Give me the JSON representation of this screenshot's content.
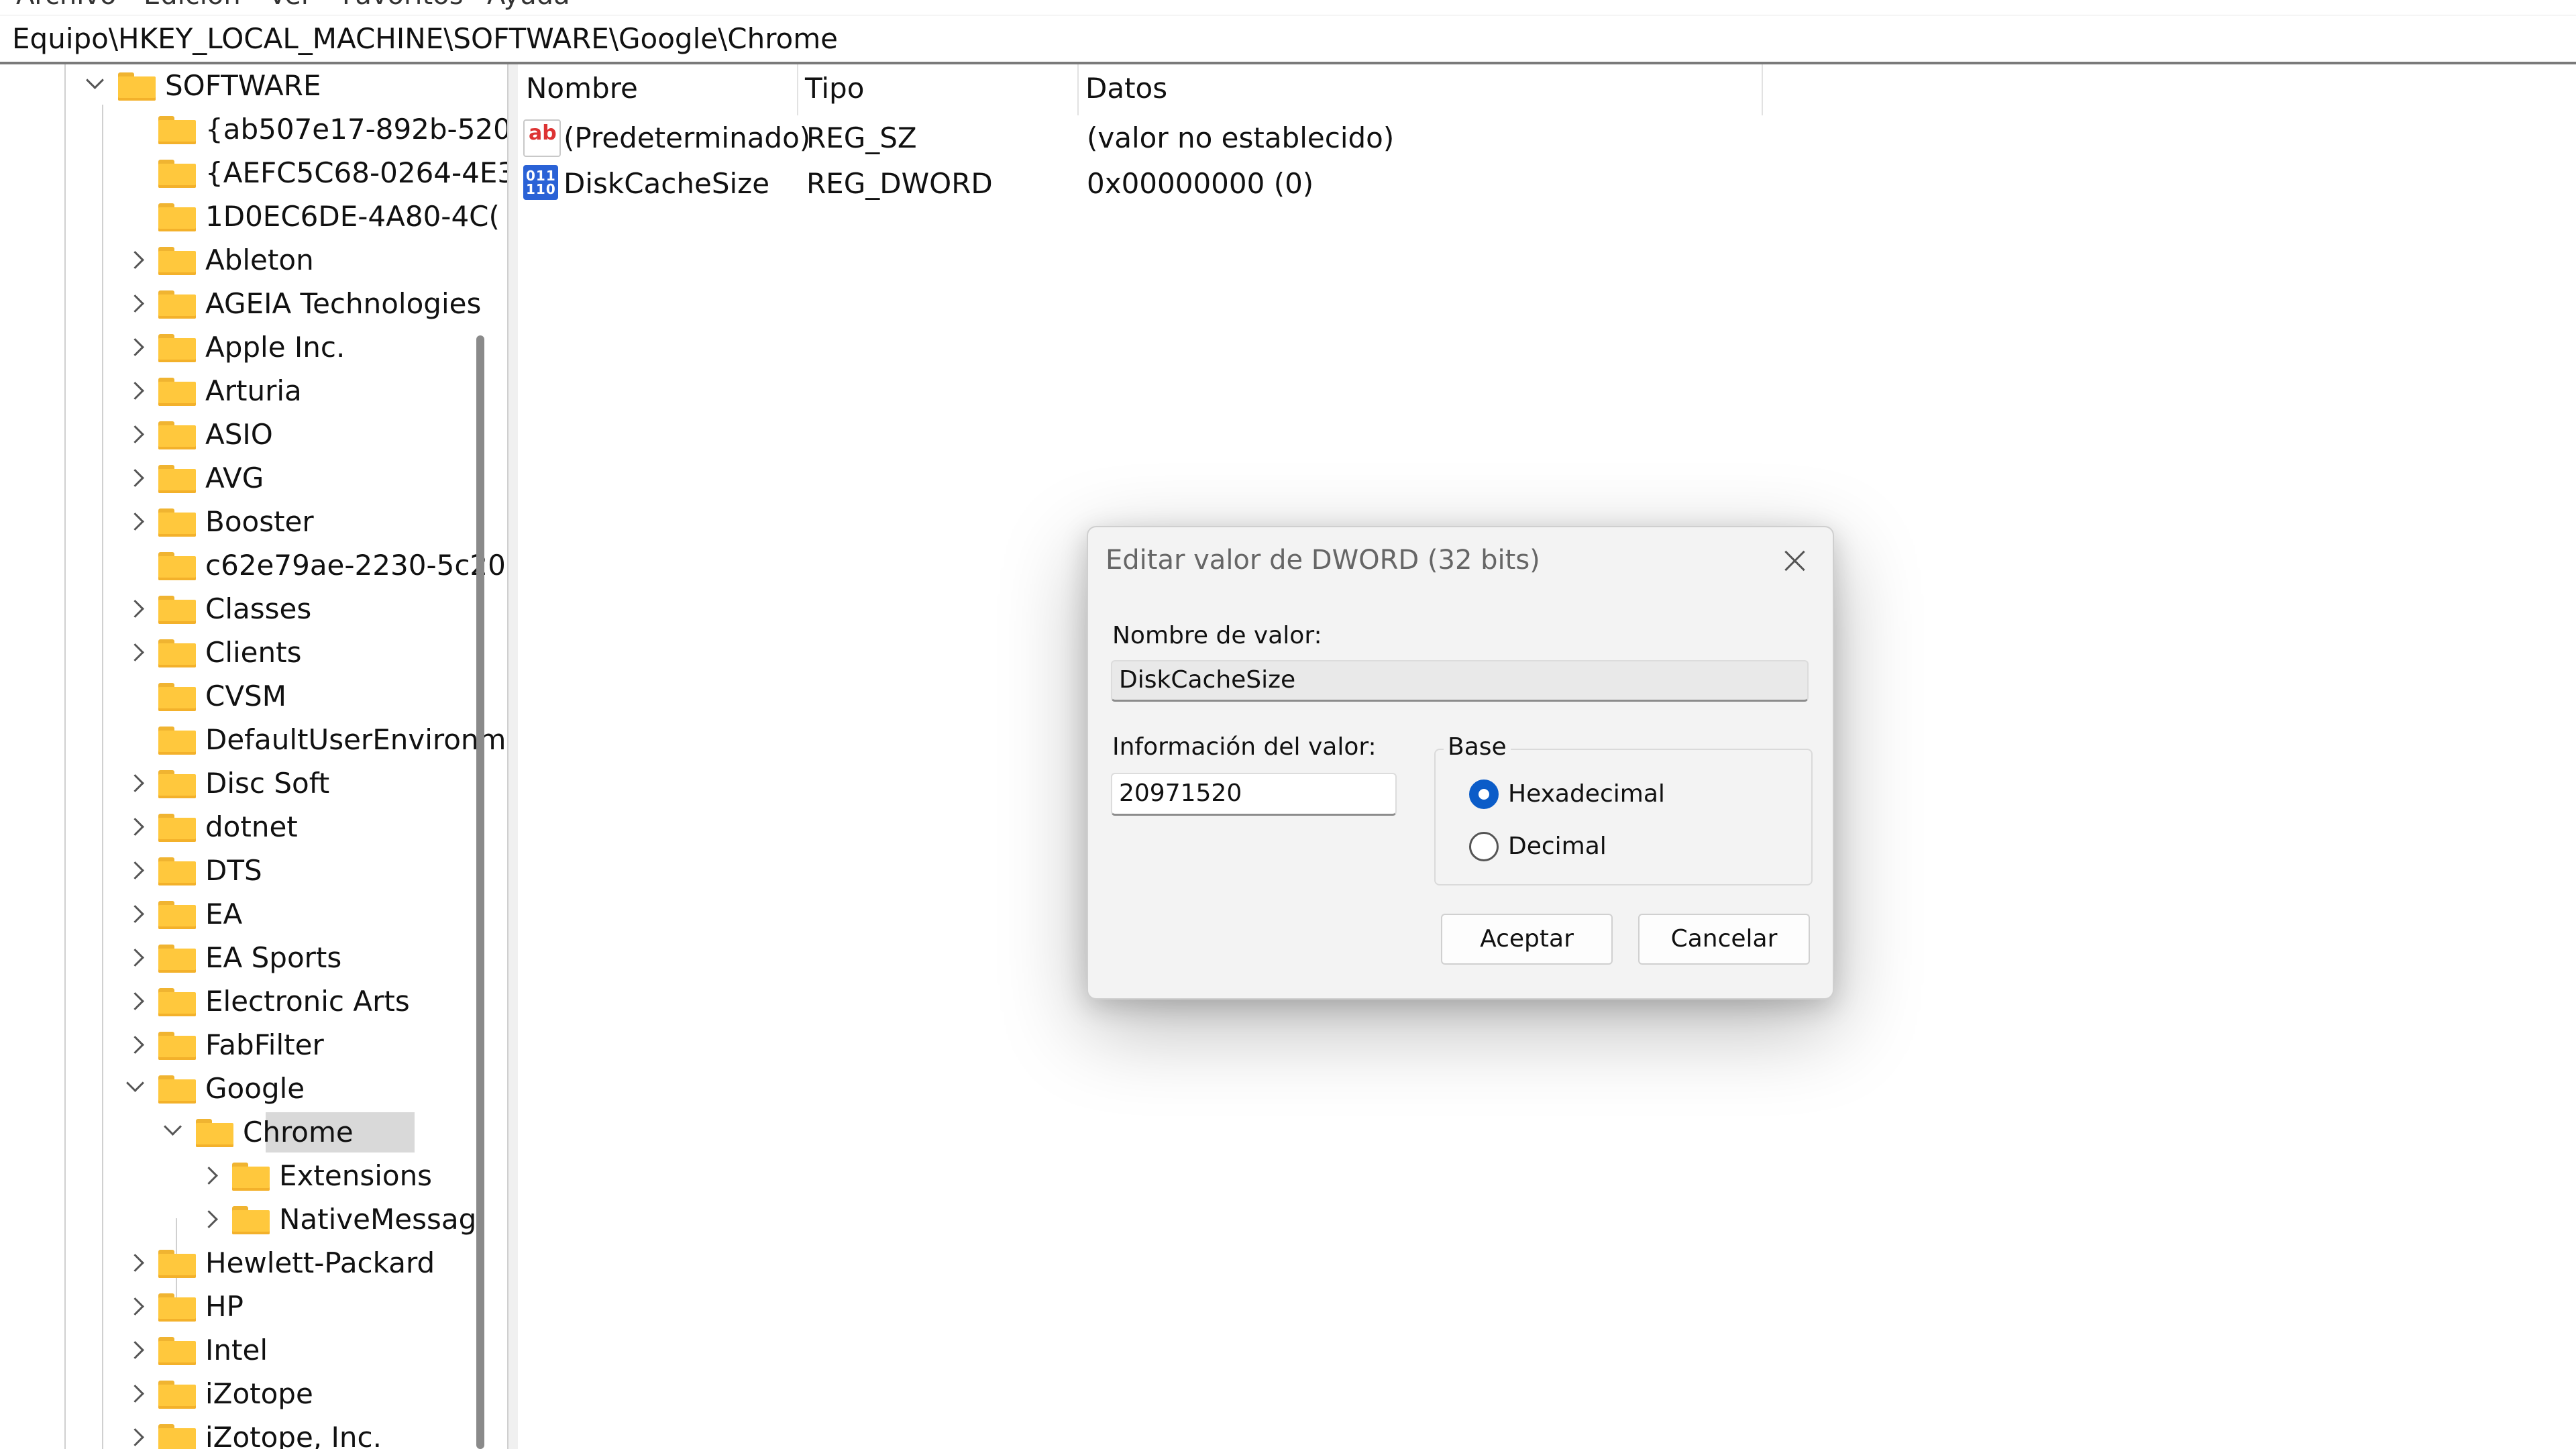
{
  "menubar": {
    "items": [
      "Archivo",
      "Edición",
      "Ver",
      "Favoritos",
      "Ayuda"
    ]
  },
  "address_bar": {
    "path": "Equipo\\HKEY_LOCAL_MACHINE\\SOFTWARE\\Google\\Chrome"
  },
  "tree": {
    "nodes": [
      {
        "label": "SOFTWARE",
        "expanded": true
      },
      {
        "label": "{ab507e17-892b-520"
      },
      {
        "label": "{AEFC5C68-0264-4E3"
      },
      {
        "label": "1D0EC6DE-4A80-4C("
      },
      {
        "label": "Ableton"
      },
      {
        "label": "AGEIA Technologies"
      },
      {
        "label": "Apple Inc."
      },
      {
        "label": "Arturia"
      },
      {
        "label": "ASIO"
      },
      {
        "label": "AVG"
      },
      {
        "label": "Booster"
      },
      {
        "label": "c62e79ae-2230-5c20"
      },
      {
        "label": "Classes"
      },
      {
        "label": "Clients"
      },
      {
        "label": "CVSM"
      },
      {
        "label": "DefaultUserEnvironm"
      },
      {
        "label": "Disc Soft"
      },
      {
        "label": "dotnet"
      },
      {
        "label": "DTS"
      },
      {
        "label": "EA"
      },
      {
        "label": "EA Sports"
      },
      {
        "label": "Electronic Arts"
      },
      {
        "label": "FabFilter"
      },
      {
        "label": "Google",
        "expanded": true
      },
      {
        "label": "Chrome",
        "expanded": true,
        "selected": true
      },
      {
        "label": "Extensions"
      },
      {
        "label": "NativeMessagi"
      },
      {
        "label": "Hewlett-Packard"
      },
      {
        "label": "HP"
      },
      {
        "label": "Intel"
      },
      {
        "label": "iZotope"
      },
      {
        "label": "iZotope, Inc."
      }
    ]
  },
  "list": {
    "columns": [
      "Nombre",
      "Tipo",
      "Datos"
    ],
    "rows": [
      {
        "name": "(Predeterminado)",
        "type": "REG_SZ",
        "data": "(valor no establecido)",
        "icon": "string-value-icon",
        "icon_text": "ab"
      },
      {
        "name": "DiskCacheSize",
        "type": "REG_DWORD",
        "data": "0x00000000 (0)",
        "icon": "binary-value-icon",
        "icon_text": "011\n110"
      }
    ]
  },
  "dialog": {
    "title": "Editar valor de DWORD (32 bits)",
    "value_name_label": "Nombre de valor:",
    "value_name": "DiskCacheSize",
    "value_data_label": "Información del valor:",
    "value_data": "20971520",
    "base_label": "Base",
    "base_options": [
      {
        "label": "Hexadecimal",
        "selected": true
      },
      {
        "label": "Decimal",
        "selected": false
      }
    ],
    "ok_label": "Aceptar",
    "cancel_label": "Cancelar"
  },
  "colors": {
    "accent": "#0b5cc8",
    "folder": "#ffc83d",
    "selection": "#d9d9d9"
  }
}
